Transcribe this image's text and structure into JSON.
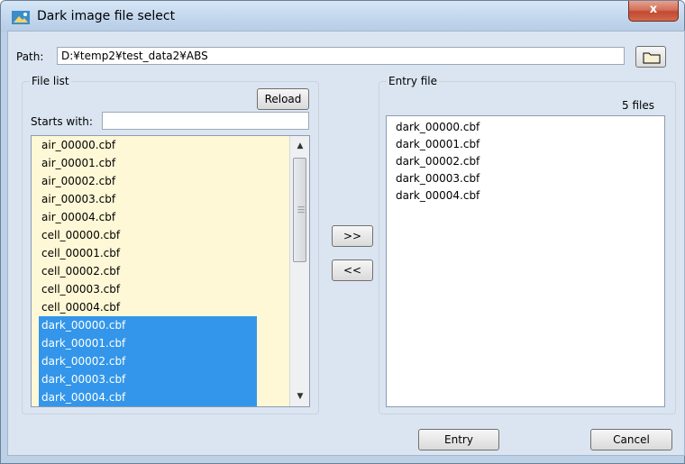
{
  "window": {
    "title": "Dark image file select",
    "close_label": "x"
  },
  "path": {
    "label": "Path:",
    "value": "D:¥temp2¥test_data2¥ABS"
  },
  "file_list": {
    "legend": "File list",
    "reload_label": "Reload",
    "starts_label": "Starts with:",
    "starts_value": "",
    "items": [
      {
        "name": "air_00000.cbf",
        "selected": false
      },
      {
        "name": "air_00001.cbf",
        "selected": false
      },
      {
        "name": "air_00002.cbf",
        "selected": false
      },
      {
        "name": "air_00003.cbf",
        "selected": false
      },
      {
        "name": "air_00004.cbf",
        "selected": false
      },
      {
        "name": "cell_00000.cbf",
        "selected": false
      },
      {
        "name": "cell_00001.cbf",
        "selected": false
      },
      {
        "name": "cell_00002.cbf",
        "selected": false
      },
      {
        "name": "cell_00003.cbf",
        "selected": false
      },
      {
        "name": "cell_00004.cbf",
        "selected": false
      },
      {
        "name": "dark_00000.cbf",
        "selected": true
      },
      {
        "name": "dark_00001.cbf",
        "selected": true
      },
      {
        "name": "dark_00002.cbf",
        "selected": true
      },
      {
        "name": "dark_00003.cbf",
        "selected": true
      },
      {
        "name": "dark_00004.cbf",
        "selected": true
      }
    ]
  },
  "transfer": {
    "add_label": ">>",
    "remove_label": "<<"
  },
  "entry_file": {
    "legend": "Entry file",
    "count": "5 files",
    "items": [
      "dark_00000.cbf",
      "dark_00001.cbf",
      "dark_00002.cbf",
      "dark_00003.cbf",
      "dark_00004.cbf"
    ]
  },
  "footer": {
    "entry_label": "Entry",
    "cancel_label": "Cancel"
  },
  "colors": {
    "selection": "#3396ea",
    "list_bg": "#fff8d6",
    "dialog_bg": "#dbe5f1"
  }
}
